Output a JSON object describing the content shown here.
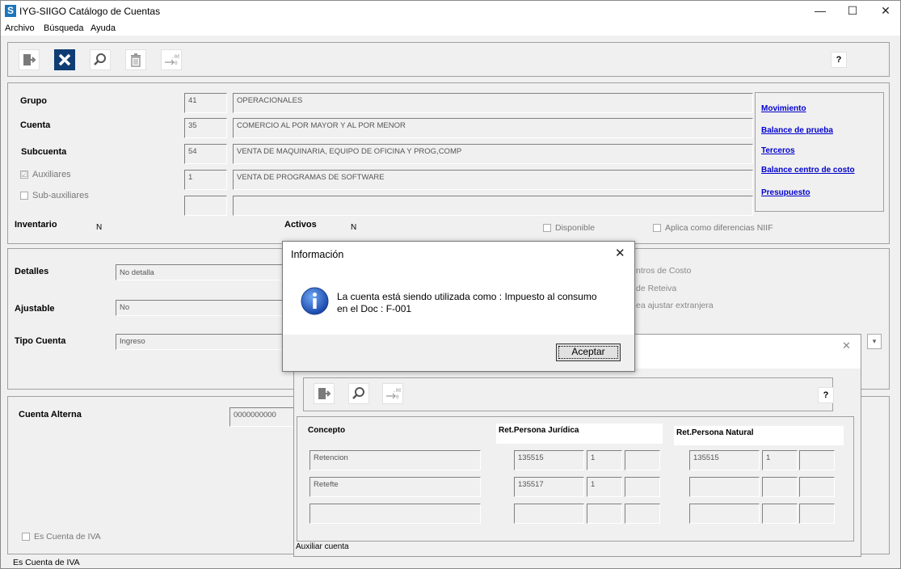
{
  "window": {
    "logo": "S",
    "title": "IYG-SIIGO  Catálogo de Cuentas",
    "minimize": "—",
    "maximize": "☐",
    "close": "✕"
  },
  "menu": [
    "Archivo",
    "Búsqueda",
    "Ayuda"
  ],
  "toolbar": {
    "help": "?"
  },
  "account": {
    "grupo_label": "Grupo",
    "grupo_code": "41",
    "grupo_name": "OPERACIONALES",
    "cuenta_label": "Cuenta",
    "cuenta_code": "35",
    "cuenta_name": "COMERCIO AL POR MAYOR Y AL  POR MENOR",
    "subcuenta_label": "Subcuenta",
    "subcuenta_code": "54",
    "subcuenta_name": "VENTA DE MAQUINARIA, EQUIPO DE OFICINA Y PROG,COMP",
    "auxiliares_label": "Auxiliares",
    "auxiliares_checked": "☑",
    "auxiliar_code": "1",
    "auxiliar_name": "VENTA DE PROGRAMAS DE SOFTWARE",
    "subaux_label": "Sub-auxiliares",
    "subaux_code": "",
    "subaux_name": "",
    "inventario_label": "Inventario",
    "inventario_value": "N",
    "activos_label": "Activos",
    "activos_value": "N",
    "disponible_label": "Disponible",
    "niif_label": "Aplica como diferencias NIIF"
  },
  "links": [
    "Movimiento",
    "Balance de prueba",
    "Terceros",
    "Balance centro de costo",
    "Presupuesto"
  ],
  "details": {
    "detalles_label": "Detalles",
    "detalles_value": "No detalla",
    "ajustable_label": "Ajustable",
    "ajustable_value": "No",
    "tipo_label": "Tipo Cuenta",
    "tipo_value": "Ingreso",
    "right_option_1": "ntros de Costo",
    "right_option_2": "de Reteiva",
    "right_option_3": "ea ajustar extranjera"
  },
  "alt": {
    "alterna_label": "Cuenta Alterna",
    "alterna_value": "0000000000",
    "iva_label": "Es Cuenta de IVA"
  },
  "status_text": "Es Cuenta de IVA",
  "dialog": {
    "title": "Información",
    "close": "✕",
    "message_line1": "La cuenta está siendo utilizada como : Impuesto al consumo",
    "message_line2": "en el Doc : F-001",
    "ok_label": "Aceptar"
  },
  "subwindow": {
    "close": "✕",
    "help": "?",
    "header_concepto": "Concepto",
    "header_juridica": "Ret.Persona Jurídica",
    "header_natural": "Ret.Persona Natural",
    "rows": [
      {
        "concepto": "Retencion",
        "jur_cuenta": "135515",
        "jur_aux": "1",
        "jur_sub": "",
        "nat_cuenta": "135515",
        "nat_aux": "1",
        "nat_sub": ""
      },
      {
        "concepto": "Retefte",
        "jur_cuenta": "135517",
        "jur_aux": "1",
        "jur_sub": "",
        "nat_cuenta": "",
        "nat_aux": "",
        "nat_sub": ""
      },
      {
        "concepto": "",
        "jur_cuenta": "",
        "jur_aux": "",
        "jur_sub": "",
        "nat_cuenta": "",
        "nat_aux": "",
        "nat_sub": ""
      }
    ],
    "status": "Auxiliar cuenta"
  }
}
